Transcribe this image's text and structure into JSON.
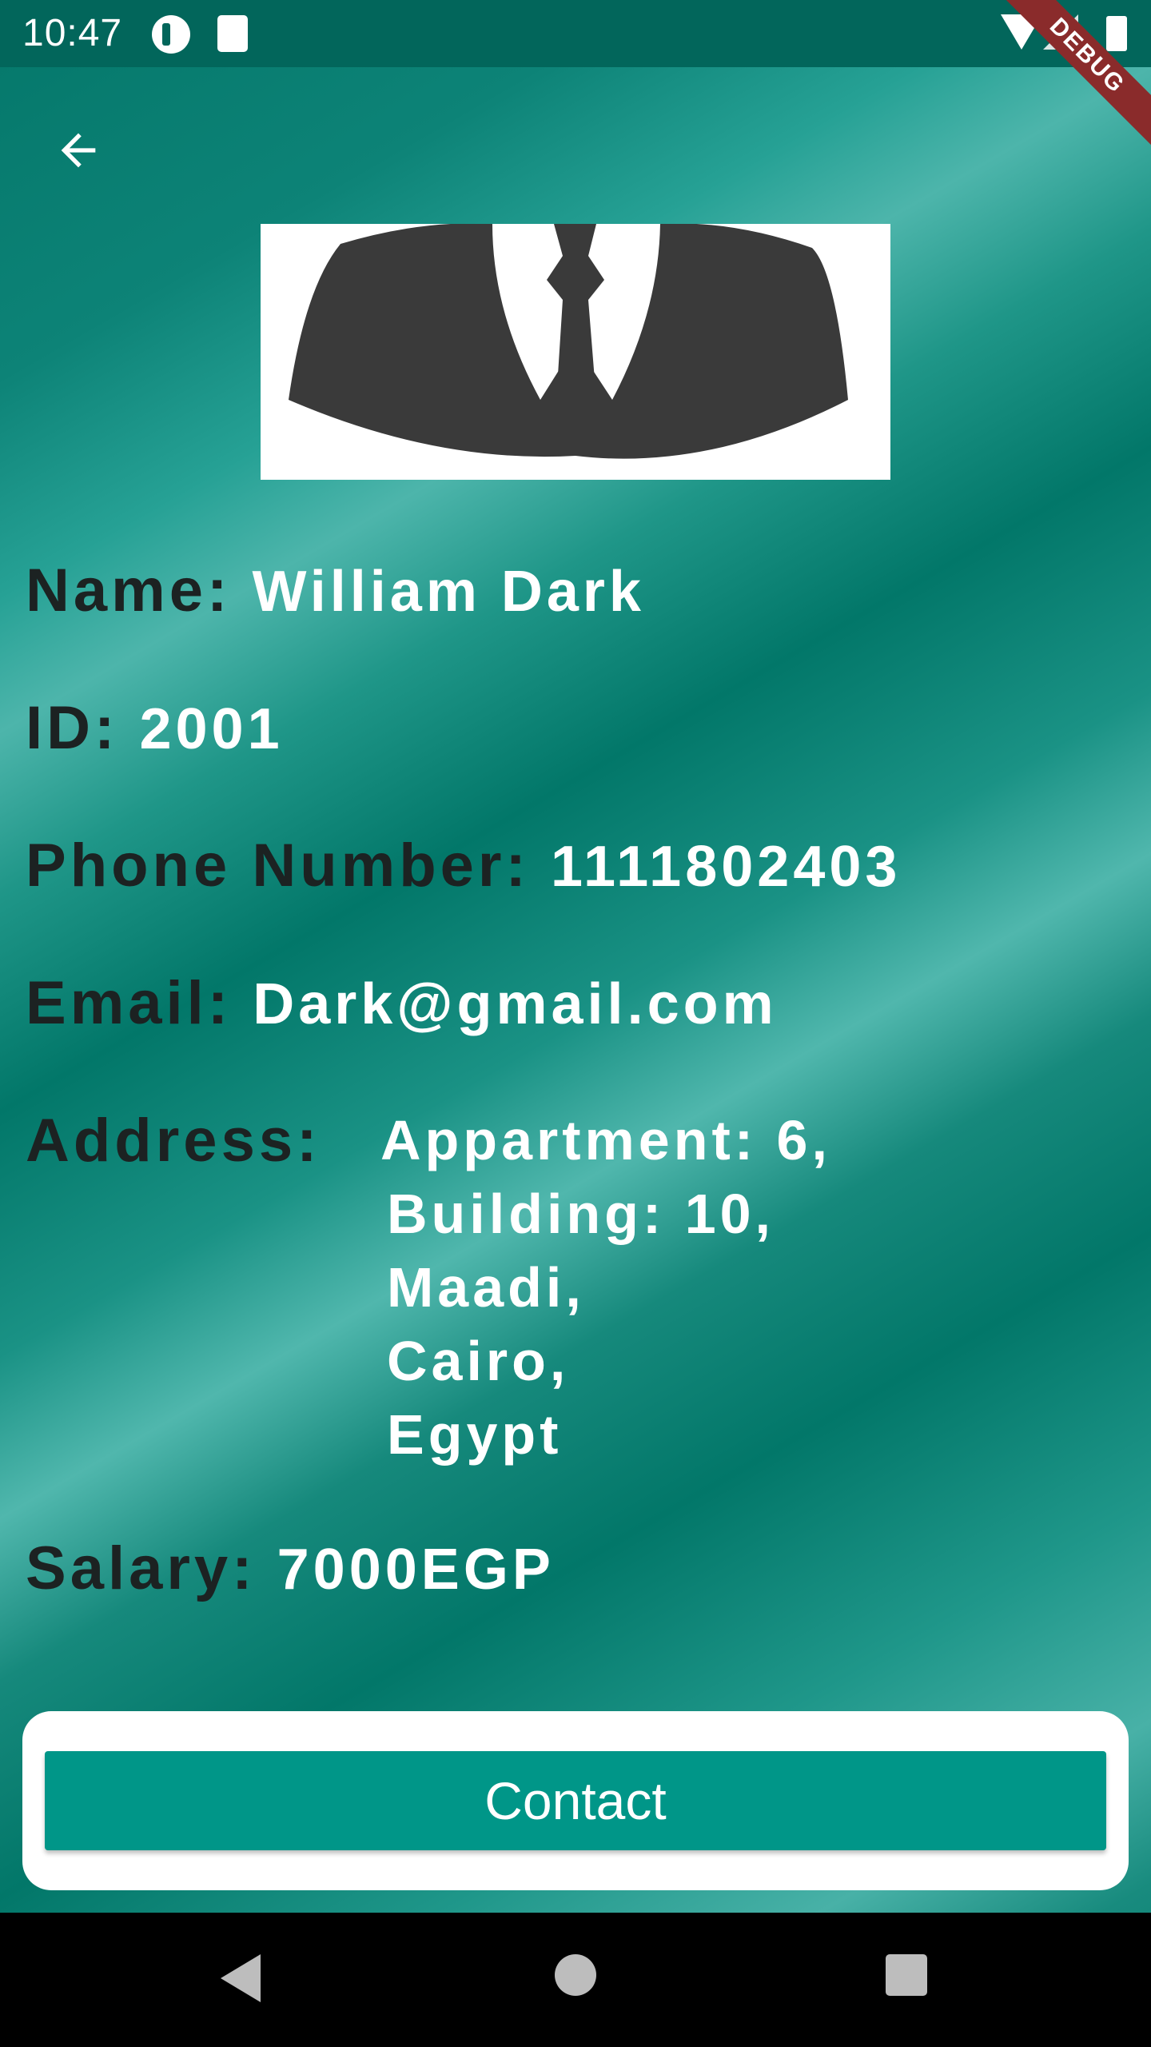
{
  "status_bar": {
    "time": "10:47",
    "icons": [
      "app-notification-icon",
      "sd-card-icon",
      "wifi-icon",
      "cell-signal-icon",
      "battery-icon"
    ],
    "debug_banner": "DEBUG"
  },
  "app_bar": {
    "back_icon": "arrow-back-icon"
  },
  "profile": {
    "avatar_icon": "business-suit-avatar-icon",
    "name_label": "Name:",
    "name_value": "William Dark",
    "id_label": "ID:",
    "id_value": "2001",
    "phone_label": "Phone Number:",
    "phone_value": "1111802403",
    "email_label": "Email:",
    "email_value": "Dark@gmail.com",
    "address_label": "Address:",
    "address_lines": [
      "Appartment: 6,",
      "Building: 10,",
      "Maadi,",
      "Cairo,",
      "Egypt"
    ],
    "salary_label": "Salary:",
    "salary_value": "7000EGP"
  },
  "actions": {
    "contact_label": "Contact"
  },
  "colors": {
    "accent": "#009688",
    "status_bar": "#02665b",
    "label_text": "#1c2222",
    "value_text": "#ffffff"
  },
  "nav_bar": {
    "icons": [
      "nav-back-icon",
      "nav-home-icon",
      "nav-recents-icon"
    ]
  }
}
